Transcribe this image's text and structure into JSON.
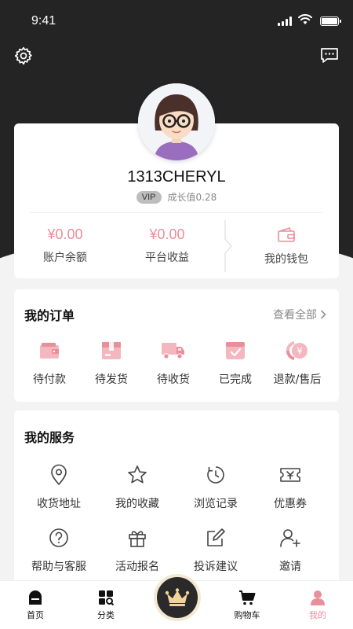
{
  "status_bar": {
    "time": "9:41"
  },
  "profile": {
    "username": "1313CHERYL",
    "vip_label": "VIP",
    "growth_label": "成长值0.28"
  },
  "finance": {
    "balance_value": "¥0.00",
    "balance_label": "账户余额",
    "income_value": "¥0.00",
    "income_label": "平台收益",
    "wallet_label": "我的钱包"
  },
  "orders": {
    "title": "我的订单",
    "see_all": "查看全部",
    "items": [
      {
        "label": "待付款",
        "icon": "wallet-icon"
      },
      {
        "label": "待发货",
        "icon": "package-icon"
      },
      {
        "label": "待收货",
        "icon": "truck-icon"
      },
      {
        "label": "已完成",
        "icon": "check-box-icon"
      },
      {
        "label": "退款/售后",
        "icon": "refund-icon"
      }
    ]
  },
  "services": {
    "title": "我的服务",
    "items": [
      {
        "label": "收货地址",
        "icon": "location-pin-icon"
      },
      {
        "label": "我的收藏",
        "icon": "star-icon"
      },
      {
        "label": "浏览记录",
        "icon": "history-icon"
      },
      {
        "label": "优惠券",
        "icon": "coupon-icon"
      },
      {
        "label": "帮助与客服",
        "icon": "help-icon"
      },
      {
        "label": "活动报名",
        "icon": "gift-icon"
      },
      {
        "label": "投诉建议",
        "icon": "edit-icon"
      },
      {
        "label": "邀请",
        "icon": "add-user-icon"
      }
    ]
  },
  "tabbar": {
    "items": [
      {
        "label": "首页",
        "icon": "home-icon"
      },
      {
        "label": "分类",
        "icon": "category-icon"
      },
      {
        "label": "购物车",
        "icon": "cart-icon"
      },
      {
        "label": "我的",
        "icon": "profile-icon"
      }
    ],
    "active": "我的",
    "center_icon": "crown-icon"
  },
  "colors": {
    "accent": "#e88f9a",
    "header_bg": "#242424",
    "page_bg": "#f3f3f3",
    "crown": "#f1d49a"
  }
}
